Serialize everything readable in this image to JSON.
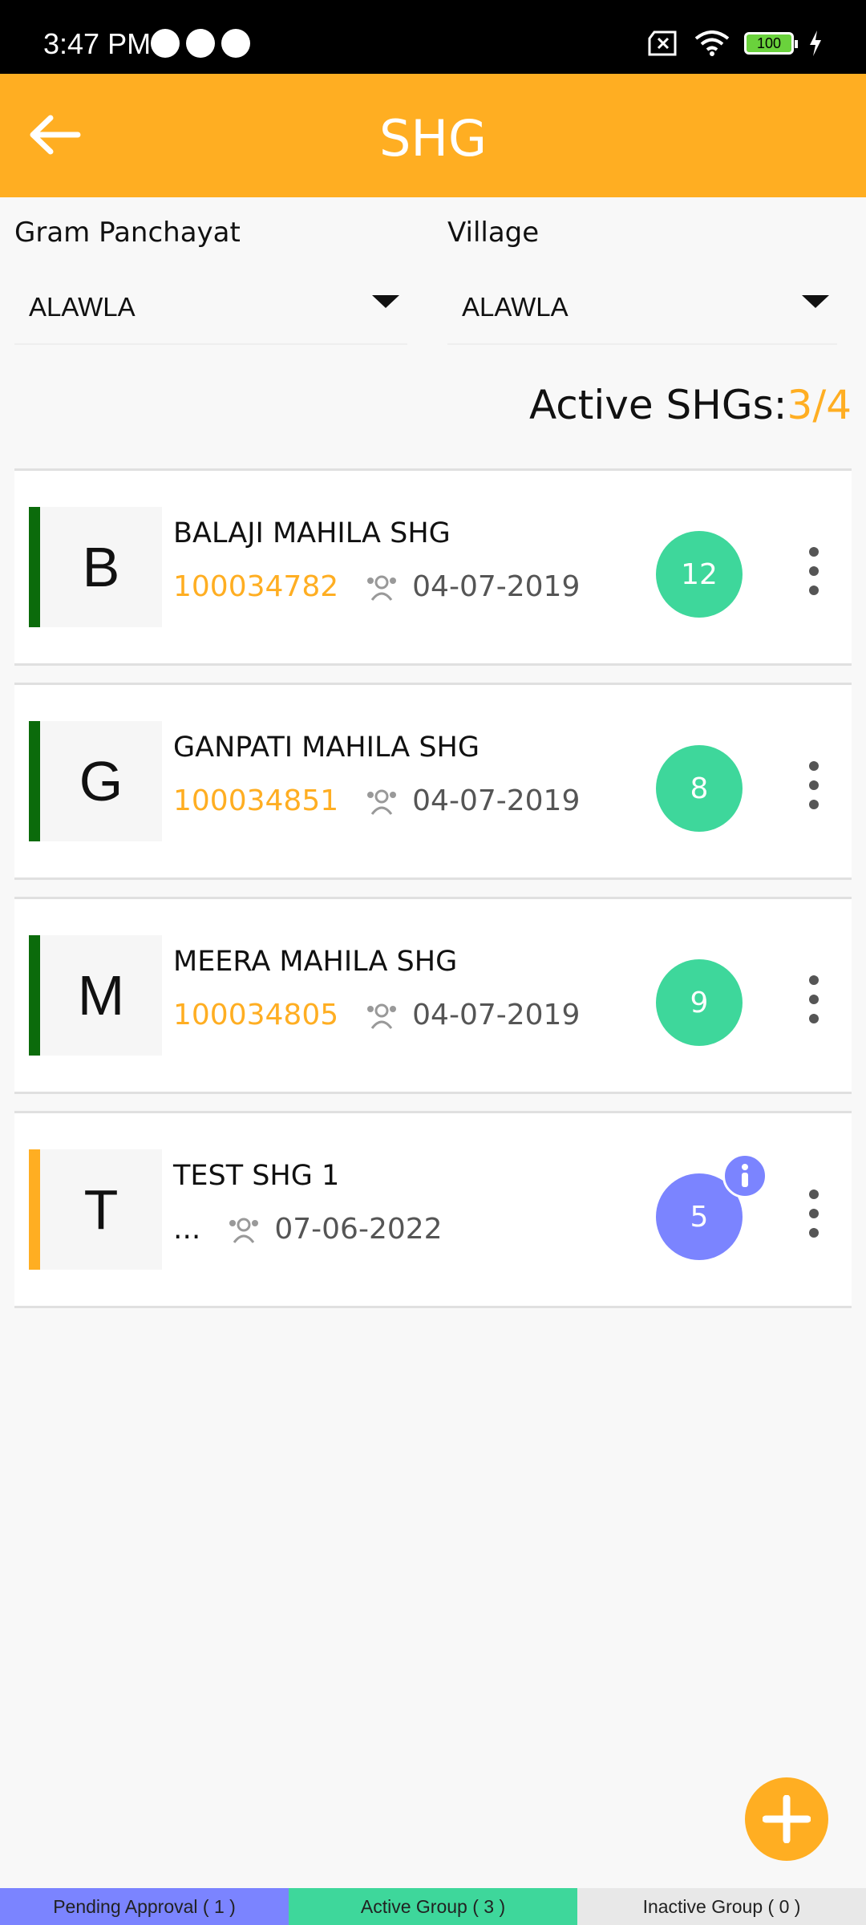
{
  "status_bar": {
    "time": "3:47 PM",
    "battery": "100"
  },
  "header": {
    "title": "SHG"
  },
  "filters": {
    "gram_panchayat": {
      "label": "Gram Panchayat",
      "value": "ALAWLA"
    },
    "village": {
      "label": "Village",
      "value": "ALAWLA"
    }
  },
  "summary": {
    "label": "Active SHGs:",
    "value": "3/4"
  },
  "shg_list": [
    {
      "initial": "B",
      "name": "BALAJI MAHILA SHG",
      "code": "100034782",
      "date": "04-07-2019",
      "members": "12",
      "status_color": "#0b6b0b",
      "badge_color": "#3ed79b"
    },
    {
      "initial": "G",
      "name": "GANPATI MAHILA SHG",
      "code": "100034851",
      "date": "04-07-2019",
      "members": "8",
      "status_color": "#0b6b0b",
      "badge_color": "#3ed79b"
    },
    {
      "initial": "M",
      "name": "MEERA MAHILA SHG",
      "code": "100034805",
      "date": "04-07-2019",
      "members": "9",
      "status_color": "#0b6b0b",
      "badge_color": "#3ed79b"
    },
    {
      "initial": "T",
      "name": "TEST SHG 1",
      "code": "...",
      "date": "07-06-2022",
      "members": "5",
      "status_color": "#ffae22",
      "badge_color": "#7b84ff"
    }
  ],
  "bottom_tabs": [
    {
      "label": "Pending Approval ( 1 )",
      "color": "#7b84ff"
    },
    {
      "label": "Active Group ( 3 )",
      "color": "#3ed79b"
    },
    {
      "label": "Inactive Group ( 0 )",
      "color": "#e8e8e8"
    }
  ],
  "colors": {
    "accent": "#ffae22",
    "active_badge": "#3ed79b",
    "pending_badge": "#7b84ff"
  }
}
